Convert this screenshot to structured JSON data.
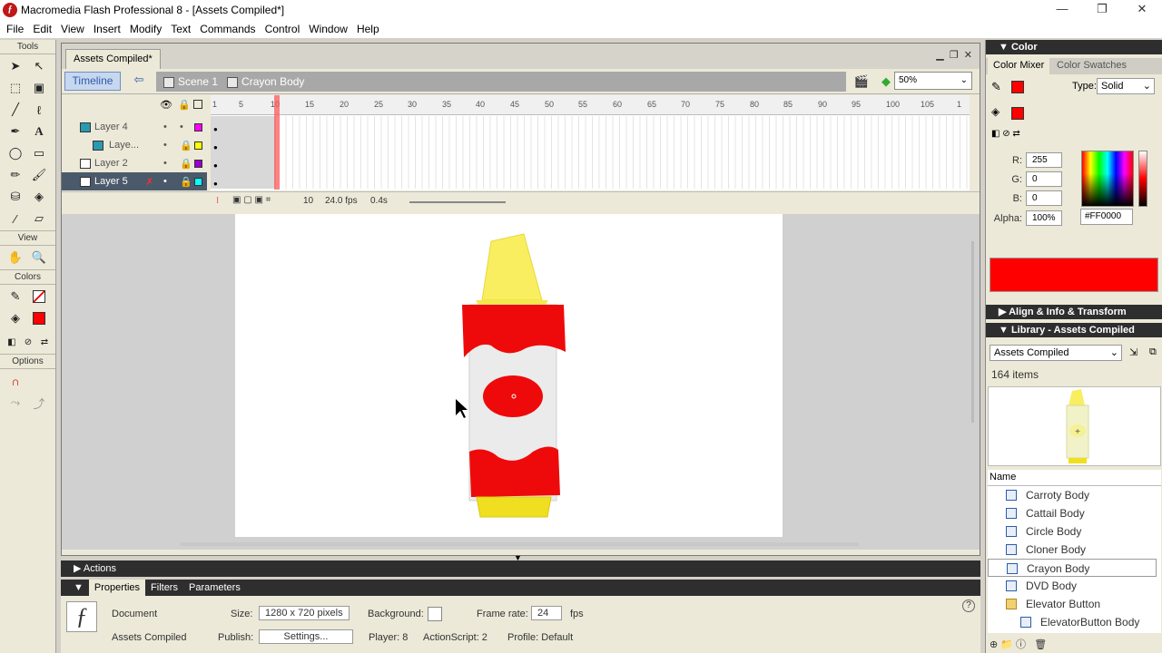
{
  "window": {
    "title": "Macromedia Flash Professional 8 - [Assets Compiled*]",
    "minimize": "—",
    "restore": "❐",
    "close": "✕"
  },
  "menu": [
    "File",
    "Edit",
    "View",
    "Insert",
    "Modify",
    "Text",
    "Commands",
    "Control",
    "Window",
    "Help"
  ],
  "tools": {
    "title": "Tools",
    "view_label": "View",
    "colors_label": "Colors",
    "options_label": "Options"
  },
  "document": {
    "tab": "Assets Compiled*",
    "timeline_button": "Timeline",
    "scene": "Scene 1",
    "symbol": "Crayon Body",
    "zoom": "50%"
  },
  "timeline": {
    "layers": [
      {
        "name": "Layer 4",
        "color": "#ff00ff"
      },
      {
        "name": "Laye...",
        "color": "#ffff00"
      },
      {
        "name": "Layer 2",
        "color": "#9900cc"
      },
      {
        "name": "Layer 5",
        "color": "#00ffff"
      }
    ],
    "ruler": [
      "1",
      "5",
      "10",
      "15",
      "20",
      "25",
      "30",
      "35",
      "40",
      "45",
      "50",
      "55",
      "60",
      "65",
      "70",
      "75",
      "80",
      "85",
      "90",
      "95",
      "100",
      "105",
      "1"
    ],
    "current_frame": "10",
    "fps": "24.0 fps",
    "time": "0.4s"
  },
  "panels": {
    "actions": "Actions",
    "properties_tabs": [
      "Properties",
      "Filters",
      "Parameters"
    ]
  },
  "properties": {
    "type": "Document",
    "name": "Assets Compiled",
    "size_label": "Size:",
    "size_value": "1280 x 720 pixels",
    "background_label": "Background:",
    "framerate_label": "Frame rate:",
    "framerate_value": "24",
    "fps_unit": "fps",
    "publish_label": "Publish:",
    "settings_button": "Settings...",
    "player": "Player: 8",
    "actionscript": "ActionScript:  2",
    "profile": "Profile:  Default"
  },
  "color_panel": {
    "title": "Color",
    "tabs": [
      "Color Mixer",
      "Color Swatches"
    ],
    "type_label": "Type:",
    "type_value": "Solid",
    "r_label": "R:",
    "r": "255",
    "g_label": "G:",
    "g": "0",
    "b_label": "B:",
    "b": "0",
    "alpha_label": "Alpha:",
    "alpha": "100%",
    "hex": "#FF0000",
    "fill_color": "#ff0000"
  },
  "align_panel": {
    "title": "Align & Info & Transform"
  },
  "library": {
    "title": "Library - Assets Compiled",
    "selector": "Assets Compiled",
    "count": "164 items",
    "name_header": "Name",
    "items": [
      {
        "name": "Carroty Body",
        "kind": "symbol"
      },
      {
        "name": "Cattail Body",
        "kind": "symbol"
      },
      {
        "name": "Circle Body",
        "kind": "symbol"
      },
      {
        "name": "Cloner Body",
        "kind": "symbol"
      },
      {
        "name": "Crayon Body",
        "kind": "symbol",
        "selected": true
      },
      {
        "name": "DVD Body",
        "kind": "symbol"
      },
      {
        "name": "Elevator Button",
        "kind": "folder"
      },
      {
        "name": "ElevatorButton Body",
        "kind": "symbol"
      }
    ]
  }
}
